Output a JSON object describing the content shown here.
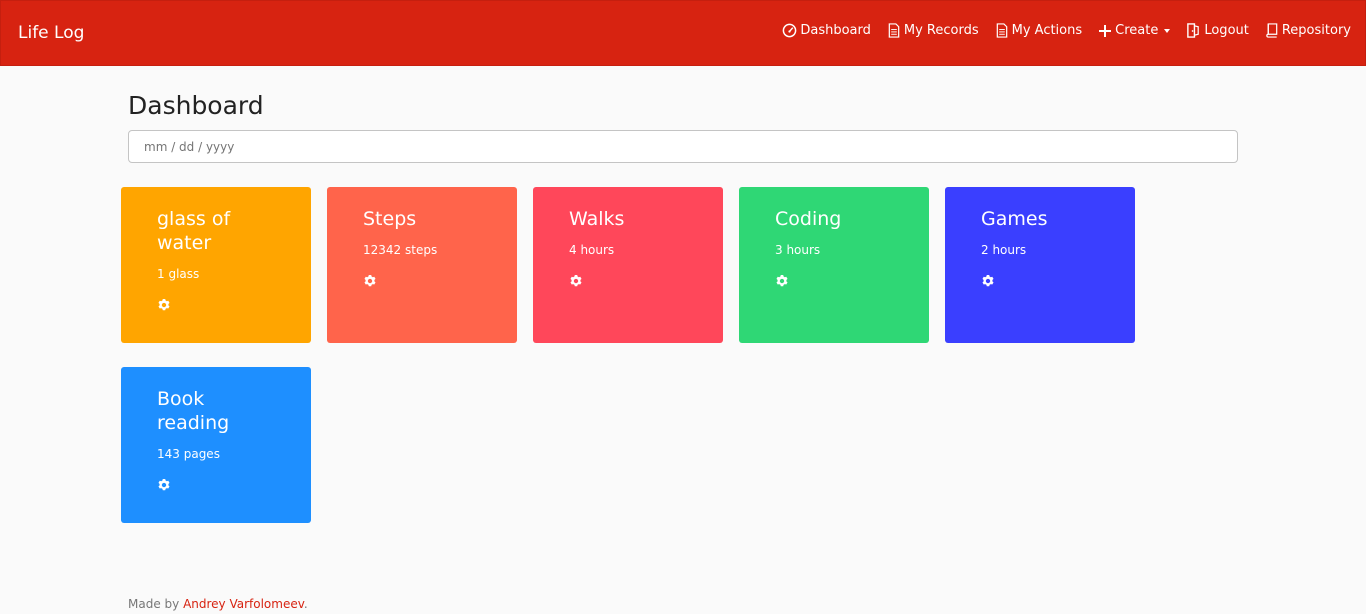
{
  "navbar": {
    "brand": "Life Log",
    "color": "#d72311",
    "items": [
      {
        "label": "Dashboard",
        "icon": "dashboard-gauge-icon"
      },
      {
        "label": "My Records",
        "icon": "document-icon"
      },
      {
        "label": "My Actions",
        "icon": "document-icon"
      },
      {
        "label": "Create",
        "icon": "plus-icon",
        "dropdown": true
      },
      {
        "label": "Logout",
        "icon": "logout-door-icon"
      },
      {
        "label": "Repository",
        "icon": "book-icon"
      }
    ]
  },
  "main": {
    "title": "Dashboard",
    "date_placeholder": "mm / dd / yyyy"
  },
  "cards": [
    {
      "title_line1": "glass of",
      "title_line2": "water",
      "value": "1 glass",
      "color": "#ffa500",
      "icon": "gear-icon"
    },
    {
      "title_line1": "Steps",
      "title_line2": "",
      "value": "12342 steps",
      "color": "#ff644b",
      "icon": "gear-icon"
    },
    {
      "title_line1": "Walks",
      "title_line2": "",
      "value": "4 hours",
      "color": "#ff475a",
      "icon": "gear-icon"
    },
    {
      "title_line1": "Coding",
      "title_line2": "",
      "value": "3 hours",
      "color": "#2fd775",
      "icon": "gear-icon"
    },
    {
      "title_line1": "Games",
      "title_line2": "",
      "value": "2 hours",
      "color": "#3a3fff",
      "icon": "gear-icon"
    },
    {
      "title_line1": "Book",
      "title_line2": "reading",
      "value": "143 pages",
      "color": "#1e8fff",
      "icon": "gear-icon"
    }
  ],
  "footer": {
    "prefix": "Made by ",
    "author": "Andrey Varfolomeev",
    "suffix": "."
  }
}
